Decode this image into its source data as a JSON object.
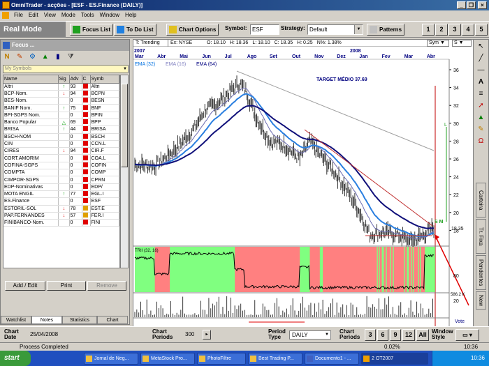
{
  "window": {
    "title": "OmniTrader - acções - [ESF - ES.Finance (DAILY)]",
    "controls": {
      "minimize": "_",
      "restore": "❐",
      "close": "×"
    }
  },
  "menu": [
    "File",
    "Edit",
    "View",
    "Mode",
    "Tools",
    "Window",
    "Help"
  ],
  "toolbar": {
    "mode": "Real Mode",
    "focus_list": "Focus List",
    "todo_list": "To Do List",
    "chart_options": "Chart Options",
    "symbol_label": "Symbol:",
    "symbol_value": "ESF",
    "strategy_label": "Strategy:",
    "strategy_value": "Default",
    "patterns": "Patterns",
    "numbers": [
      "1",
      "2",
      "3",
      "4",
      "5"
    ]
  },
  "focus": {
    "title": "Focus ...",
    "icons": [
      "N-icon",
      "pencil-icon",
      "multi-icon",
      "chart-icon",
      "bars-icon",
      "filter-icon"
    ],
    "symbols_combo": "My Symbols",
    "columns": [
      "Name",
      "Sig",
      "Adv",
      "C",
      "Symb"
    ],
    "rows": [
      {
        "name": "Altri",
        "sig": "up",
        "adv": "93",
        "c": "r",
        "sym": "Altri"
      },
      {
        "name": "BCP-Nom.",
        "sig": "dn",
        "adv": "94",
        "c": "r",
        "sym": "BCPN"
      },
      {
        "name": "BES-Nom.",
        "sig": "",
        "adv": "0",
        "c": "r",
        "sym": "BESN"
      },
      {
        "name": "BANIF Nom.",
        "sig": "up",
        "adv": "75",
        "c": "r",
        "sym": "BNF"
      },
      {
        "name": "BPI-SGPS Nom.",
        "sig": "",
        "adv": "0",
        "c": "r",
        "sym": "BPIN"
      },
      {
        "name": "Banco Popular",
        "sig": "tri",
        "adv": "69",
        "c": "r",
        "sym": "BPP"
      },
      {
        "name": "BRISA",
        "sig": "up",
        "adv": "44",
        "c": "r",
        "sym": "BRISA"
      },
      {
        "name": "BSCH-NOM",
        "sig": "",
        "adv": "0",
        "c": "r",
        "sym": "BSCH"
      },
      {
        "name": "CIN",
        "sig": "",
        "adv": "0",
        "c": "r",
        "sym": "CCN.L"
      },
      {
        "name": "CIRES",
        "sig": "dn",
        "adv": "94",
        "c": "r",
        "sym": "CIR.F"
      },
      {
        "name": "CORT.AMORIM",
        "sig": "",
        "adv": "0",
        "c": "r",
        "sym": "COA.L"
      },
      {
        "name": "COFINA-SGPS",
        "sig": "",
        "adv": "0",
        "c": "r",
        "sym": "COFIN"
      },
      {
        "name": "COMPTA",
        "sig": "",
        "adv": "0",
        "c": "r",
        "sym": "COMP"
      },
      {
        "name": "CIMPOR-SGPS",
        "sig": "",
        "adv": "0",
        "c": "r",
        "sym": "CPRN"
      },
      {
        "name": "EDP-Nominativas",
        "sig": "",
        "adv": "0",
        "c": "r",
        "sym": "EDP/"
      },
      {
        "name": "MOTA ENGIL",
        "sig": "up",
        "adv": "77",
        "c": "r",
        "sym": "EGL.I"
      },
      {
        "name": "ES.Finance",
        "sig": "",
        "adv": "0",
        "c": "r",
        "sym": "ESF"
      },
      {
        "name": "ESTORIL-SOL",
        "sig": "dn",
        "adv": "78",
        "c": "y",
        "sym": "EST.E"
      },
      {
        "name": "PAP.FERNANDES",
        "sig": "dn",
        "adv": "57",
        "c": "y",
        "sym": "FER.I"
      },
      {
        "name": "FINIBANCO-Nom.",
        "sig": "",
        "adv": "0",
        "c": "r",
        "sym": "FINI"
      }
    ],
    "add_edit": "Add / Edit",
    "print": "Print",
    "remove": "Remove",
    "tabs": [
      "Watchlist",
      "Notes",
      "Statistics",
      "Chart"
    ]
  },
  "chart": {
    "info": [
      "T: Trending",
      "Ex: NYSE",
      "O: 18.10",
      "H: 18.36",
      "L: 18.10",
      "C: 18.35",
      "H: 0.25",
      "N%: 1.38%"
    ],
    "sym_combo": "Sym",
    "s_combo": "S",
    "year_left": "2007",
    "year_right": "2008",
    "month_labels": [
      "Mar",
      "Abr",
      "Mai",
      "Jun",
      "Jul",
      "Ago",
      "Set",
      "Out",
      "Nov",
      "Dez",
      "Jan",
      "Fev",
      "Mar",
      "Abr"
    ],
    "ema_labels": [
      {
        "text": "EMA (32)",
        "color": "#0070e0"
      },
      {
        "text": "EMA (16)",
        "color": "#8080c0"
      },
      {
        "text": "EMA (64)",
        "color": "#000080"
      }
    ],
    "target_text": "TARGET MÉDIO 37.69",
    "price_ticks": [
      "36",
      "34",
      "32",
      "30",
      "28",
      "26",
      "24",
      "22",
      "20",
      "18"
    ],
    "last_price": "18.35",
    "trend_label": "TRII (32, 16)",
    "osc_ticks": [
      "80",
      "20"
    ],
    "volume_label": "586.2 K",
    "vote_label": "Vote",
    "sm_label": "S M",
    "l_label": "L",
    "colors": {
      "price": "#000000",
      "ema16": "#6b6bb0",
      "ema32": "#2a7fe0",
      "ema64": "#10107a",
      "green": "#80ff80",
      "red": "#ff8080"
    }
  },
  "right_panel": {
    "tabs": [
      "Carteira",
      "Tr. Fixa",
      "Pendentes",
      "New"
    ],
    "tools": [
      "cursor-icon",
      "line-icon",
      "hline-icon",
      "text-icon",
      "fib-icon",
      "arrow-icon",
      "triangle-icon",
      "pencil-icon",
      "magnet-icon"
    ]
  },
  "bottom": {
    "chart_date_label": "Chart\nDate",
    "chart_date_value": "25/04/2008",
    "chart_periods_label": "Chart\nPeriods",
    "chart_periods_value": "300",
    "period_type_label": "Period\nType",
    "period_type_value": "DAILY",
    "chart_periods2_label": "Chart\nPeriods",
    "period_buttons": [
      "3",
      "6",
      "9",
      "12",
      "All"
    ],
    "window_style_label": "Window\nStyle"
  },
  "status": {
    "text": "Process Completed",
    "zoom": "0.02%",
    "time": "10:36"
  },
  "taskbar": {
    "start": "start",
    "tasks": [
      "Jornal de Neg...",
      "MetaStock Pro...",
      "PhotoFiltre",
      "Best Trading P...",
      "Documento1 - ...",
      "2 OT2007"
    ],
    "clock": "10:36"
  }
}
